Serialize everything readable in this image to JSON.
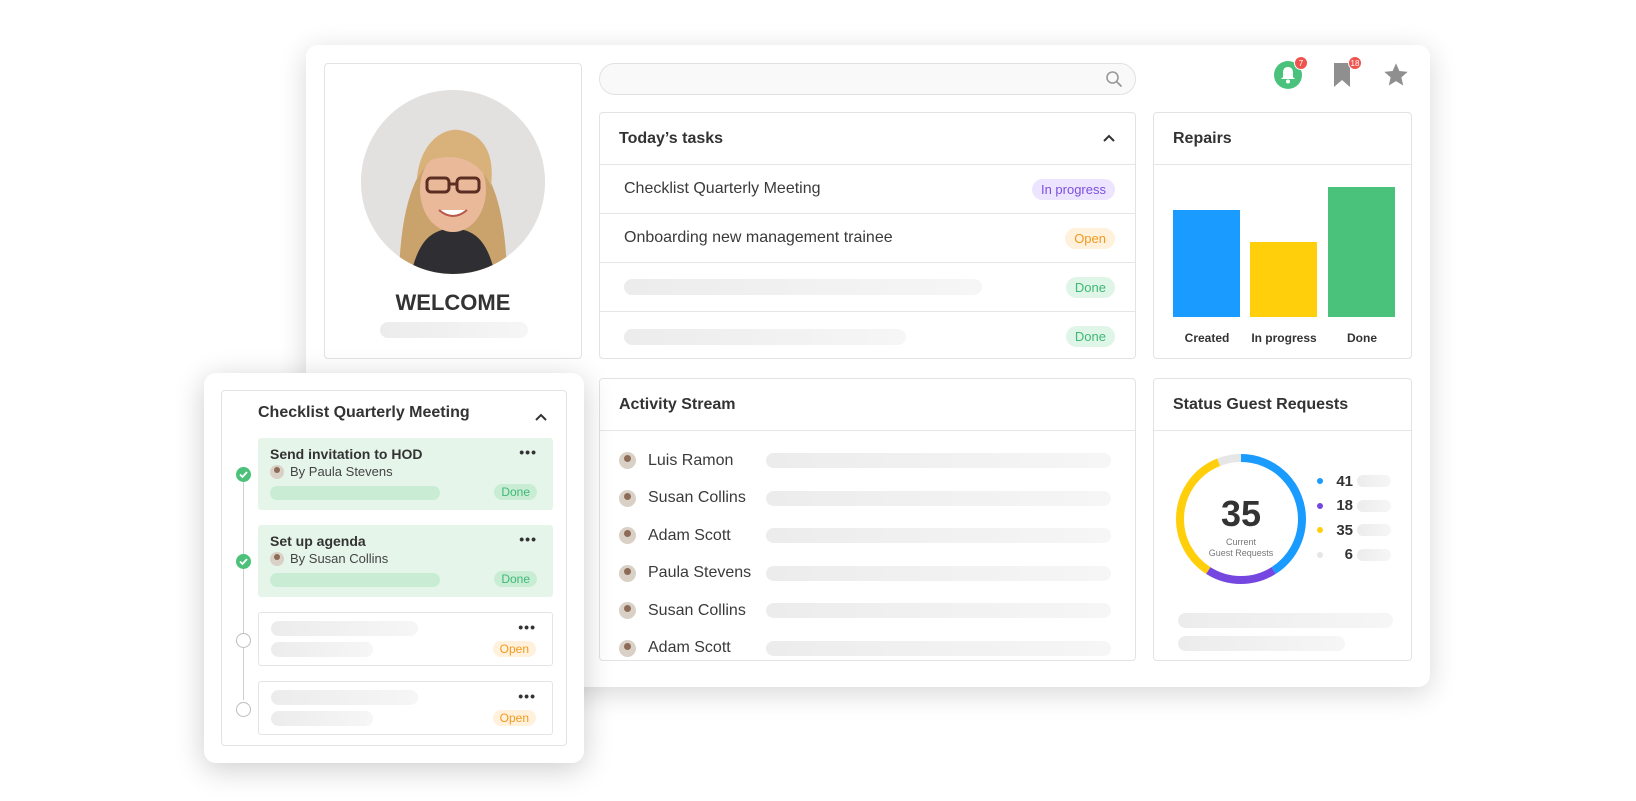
{
  "profile": {
    "welcome": "WELCOME"
  },
  "search": {
    "placeholder": ""
  },
  "notifications": {
    "bell_count": "7",
    "bookmark_count": "18"
  },
  "tasks": {
    "title": "Today’s tasks",
    "rows": [
      {
        "label": "Checklist Quarterly Meeting",
        "status": "In progress"
      },
      {
        "label": "Onboarding new management trainee",
        "status": "Open"
      },
      {
        "label": "",
        "status": "Done"
      },
      {
        "label": "",
        "status": "Done"
      }
    ]
  },
  "repairs": {
    "title": "Repairs",
    "colors": [
      "#1a9bff",
      "#fecf0a",
      "#4ac27b"
    ]
  },
  "chart_data": {
    "type": "bar",
    "title": "Repairs",
    "categories": [
      "Created",
      "In progress",
      "Done"
    ],
    "values": [
      100,
      70,
      122
    ]
  },
  "activity": {
    "title": "Activity Stream",
    "rows": [
      {
        "name": "Luis Ramon"
      },
      {
        "name": "Susan Collins"
      },
      {
        "name": "Adam Scott"
      },
      {
        "name": "Paula Stevens"
      },
      {
        "name": "Susan Collins"
      },
      {
        "name": "Adam Scott"
      }
    ]
  },
  "status": {
    "title": "Status Guest Requests",
    "center_value": "35",
    "center_label_1": "Current",
    "center_label_2": "Guest Requests",
    "legend": [
      {
        "value": "41",
        "color": "#1a9bff"
      },
      {
        "value": "18",
        "color": "#7547e0"
      },
      {
        "value": "35",
        "color": "#fecf0a"
      },
      {
        "value": "6",
        "color": "#e6e6e6"
      }
    ]
  },
  "checklist": {
    "title": "Checklist Quarterly Meeting",
    "items": [
      {
        "title": "Send invitation to HOD",
        "by": "By Paula Stevens",
        "status": "Done"
      },
      {
        "title": "Set up agenda",
        "by": "By Susan Collins",
        "status": "Done"
      },
      {
        "title": "",
        "by": "",
        "status": "Open"
      },
      {
        "title": "",
        "by": "",
        "status": "Open"
      }
    ],
    "menu_glyph": "•••"
  }
}
